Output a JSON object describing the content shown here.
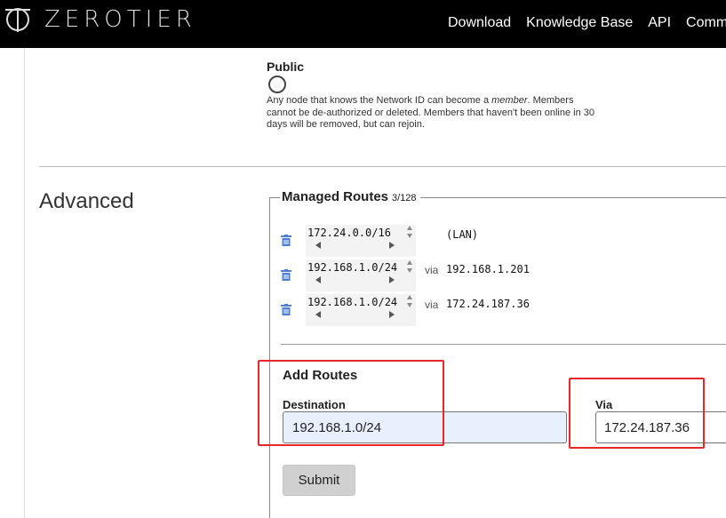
{
  "header": {
    "brand": "ZEROTIER",
    "nav": [
      "Download",
      "Knowledge Base",
      "API",
      "Commu"
    ]
  },
  "public_section": {
    "label": "Public",
    "desc_before": "Any node that knows the Network ID can become a ",
    "desc_em": "member",
    "desc_after": ". Members cannot be de-authorized or deleted. Members that haven't been online in 30 days will be removed, but can rejoin."
  },
  "advanced": {
    "title": "Advanced"
  },
  "managed_routes": {
    "legend": "Managed Routes",
    "count": "3/128",
    "routes": [
      {
        "target": "172.24.0.0/16",
        "via_label": "",
        "via": "(LAN)"
      },
      {
        "target": "192.168.1.0/24",
        "via_label": "via",
        "via": "192.168.1.201"
      },
      {
        "target": "192.168.1.0/24",
        "via_label": "via",
        "via": "172.24.187.36"
      }
    ]
  },
  "add_routes": {
    "title": "Add Routes",
    "destination_label": "Destination",
    "destination_value": "192.168.1.0/24",
    "via_label": "Via",
    "via_value": "172.24.187.36",
    "submit_label": "Submit"
  },
  "colors": {
    "header_bg": "#000000",
    "highlight": "#e8262b",
    "trash_icon": "#4a7fd4",
    "autofill_bg": "#e8f0fe"
  },
  "icons": {
    "logo": "zerotier-logo-icon",
    "delete": "trash-icon",
    "spinner_up": "chevron-up-icon",
    "spinner_down": "chevron-down-icon"
  }
}
